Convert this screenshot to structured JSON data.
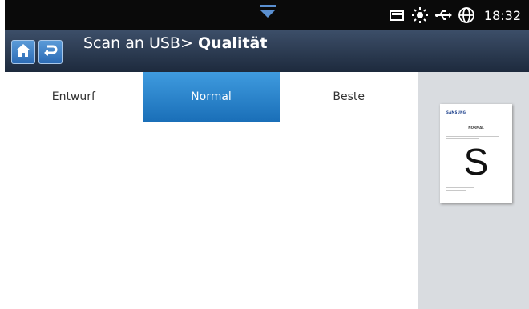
{
  "statusbar": {
    "clock": "18:32",
    "icons": [
      "sd-card-icon",
      "toner-sun-icon",
      "usb-icon",
      "globe-icon"
    ],
    "colors": {
      "background": "#0a0a0a",
      "accent": "#5a8fd0"
    }
  },
  "header": {
    "home_icon": "home-icon",
    "back_icon": "back-icon",
    "breadcrumb": "Scan an USB>",
    "title": "Qualität"
  },
  "tabs": [
    {
      "label": "Entwurf",
      "active": false
    },
    {
      "label": "Normal",
      "active": true
    },
    {
      "label": "Beste",
      "active": false
    }
  ],
  "preview": {
    "brand": "SAMSUNG",
    "heading": "NORMAL",
    "letter": "S"
  }
}
